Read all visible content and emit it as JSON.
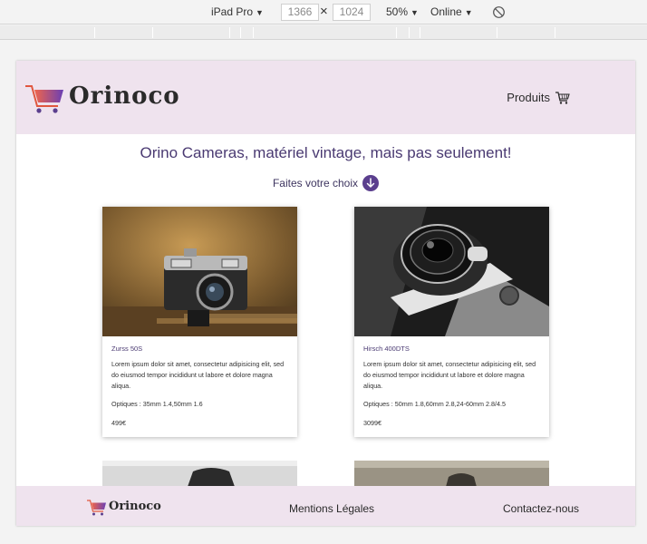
{
  "devtools": {
    "device": "iPad Pro",
    "width": "1366",
    "times": "×",
    "height": "1024",
    "zoom": "50%",
    "network": "Online",
    "rotate_icon": "rotate-icon"
  },
  "site": {
    "brand": "Orinoco",
    "nav": {
      "products": "Produits",
      "cart_icon": "cart-icon"
    },
    "headline": "Orino Cameras, matériel vintage, mais pas seulement!",
    "choose": "Faites votre choix",
    "products": [
      {
        "name": "Zurss 50S",
        "description": "Lorem ipsum dolor sit amet, consectetur adipisicing elit, sed do eiusmod tempor incididunt ut labore et dolore magna aliqua.",
        "optics": "Optiques : 35mm 1.4,50mm 1.6",
        "price": "499€"
      },
      {
        "name": "Hirsch 400DTS",
        "description": "Lorem ipsum dolor sit amet, consectetur adipisicing elit, sed do eiusmod tempor incididunt ut labore et dolore magna aliqua.",
        "optics": "Optiques : 50mm 1.8,60mm 2.8,24-60mm 2.8/4.5",
        "price": "3099€"
      }
    ],
    "footer": {
      "brand": "Orinoco",
      "legal": "Mentions Légales",
      "contact": "Contactez-nous"
    }
  },
  "colors": {
    "header_bg": "#efe3ee",
    "accent": "#5b3f8e",
    "headline": "#4a3a72"
  }
}
